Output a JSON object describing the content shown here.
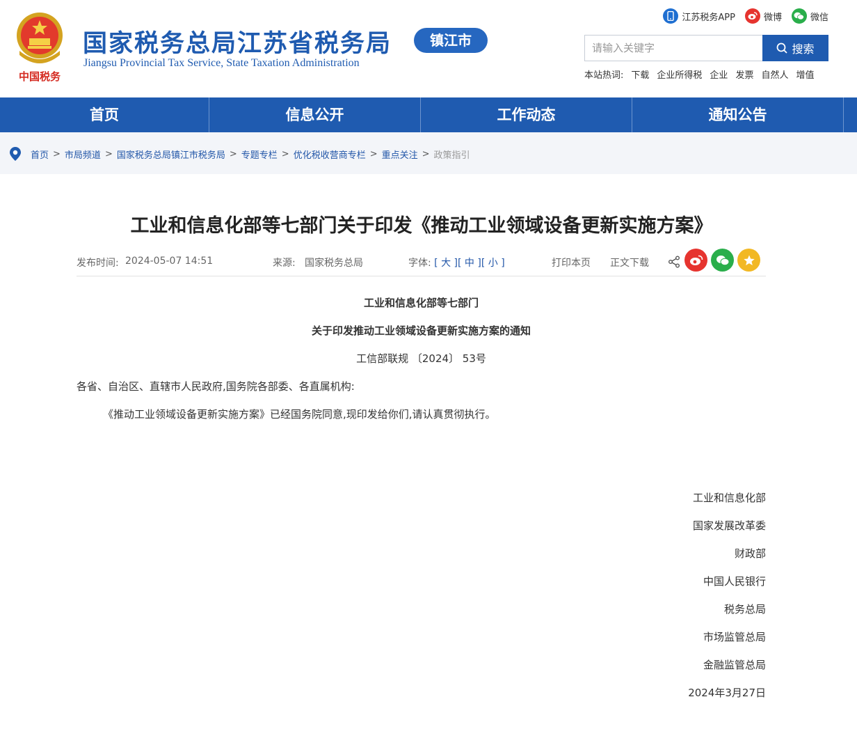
{
  "header": {
    "title_cn": "国家税务总局江苏省税务局",
    "title_en": "Jiangsu Provincial Tax Service, State Taxation Administration",
    "city_badge": "镇江市",
    "emblem_text": "中国税务",
    "top_links": [
      {
        "label": "江苏税务APP",
        "icon": "mobile-app-icon",
        "color": "#1f6fd1"
      },
      {
        "label": "微博",
        "icon": "weibo-icon",
        "color": "#e6342f"
      },
      {
        "label": "微信",
        "icon": "wechat-icon",
        "color": "#2aae4b"
      }
    ],
    "search": {
      "placeholder": "请输入关键字",
      "button": "搜索"
    },
    "hot": {
      "label": "本站热词:",
      "items": [
        "下载",
        "企业所得税",
        "企业",
        "发票",
        "自然人",
        "增值"
      ]
    }
  },
  "nav": {
    "items": [
      "首页",
      "信息公开",
      "工作动态",
      "通知公告"
    ]
  },
  "breadcrumb": {
    "icon": "location-pin-icon",
    "items": [
      "首页",
      "市局频道",
      "国家税务总局镇江市税务局",
      "专题专栏",
      "优化税收营商专栏",
      "重点关注"
    ],
    "current": "政策指引"
  },
  "article": {
    "title": "工业和信息化部等七部门关于印发《推动工业领域设备更新实施方案》",
    "meta": {
      "publish_label": "发布时间:",
      "publish_time": "2024-05-07 14:51",
      "source_label": "来源:",
      "source": "国家税务总局",
      "font_label": "字体:",
      "font_large": "[ 大 ]",
      "font_medium": "[ 中 ]",
      "font_small": "[ 小 ]",
      "print": "打印本页",
      "download": "正文下载"
    },
    "heading1": "工业和信息化部等七部门",
    "heading2": "关于印发推动工业领域设备更新实施方案的通知",
    "doc_number": "工信部联规 〔2024〕 53号",
    "salutation": "各省、自治区、直辖市人民政府,国务院各部委、各直属机构:",
    "paragraph": "《推动工业领域设备更新实施方案》已经国务院同意,现印发给你们,请认真贯彻执行。",
    "signatories": [
      "工业和信息化部",
      "国家发展改革委",
      "财政部",
      "中国人民银行",
      "税务总局",
      "市场监管总局",
      "金融监管总局"
    ],
    "date": "2024年3月27日"
  },
  "colors": {
    "brand_blue": "#1f5bb0",
    "weibo_red": "#e6342f",
    "wechat_green": "#2aae4b",
    "favorite_yellow": "#f2b824"
  }
}
